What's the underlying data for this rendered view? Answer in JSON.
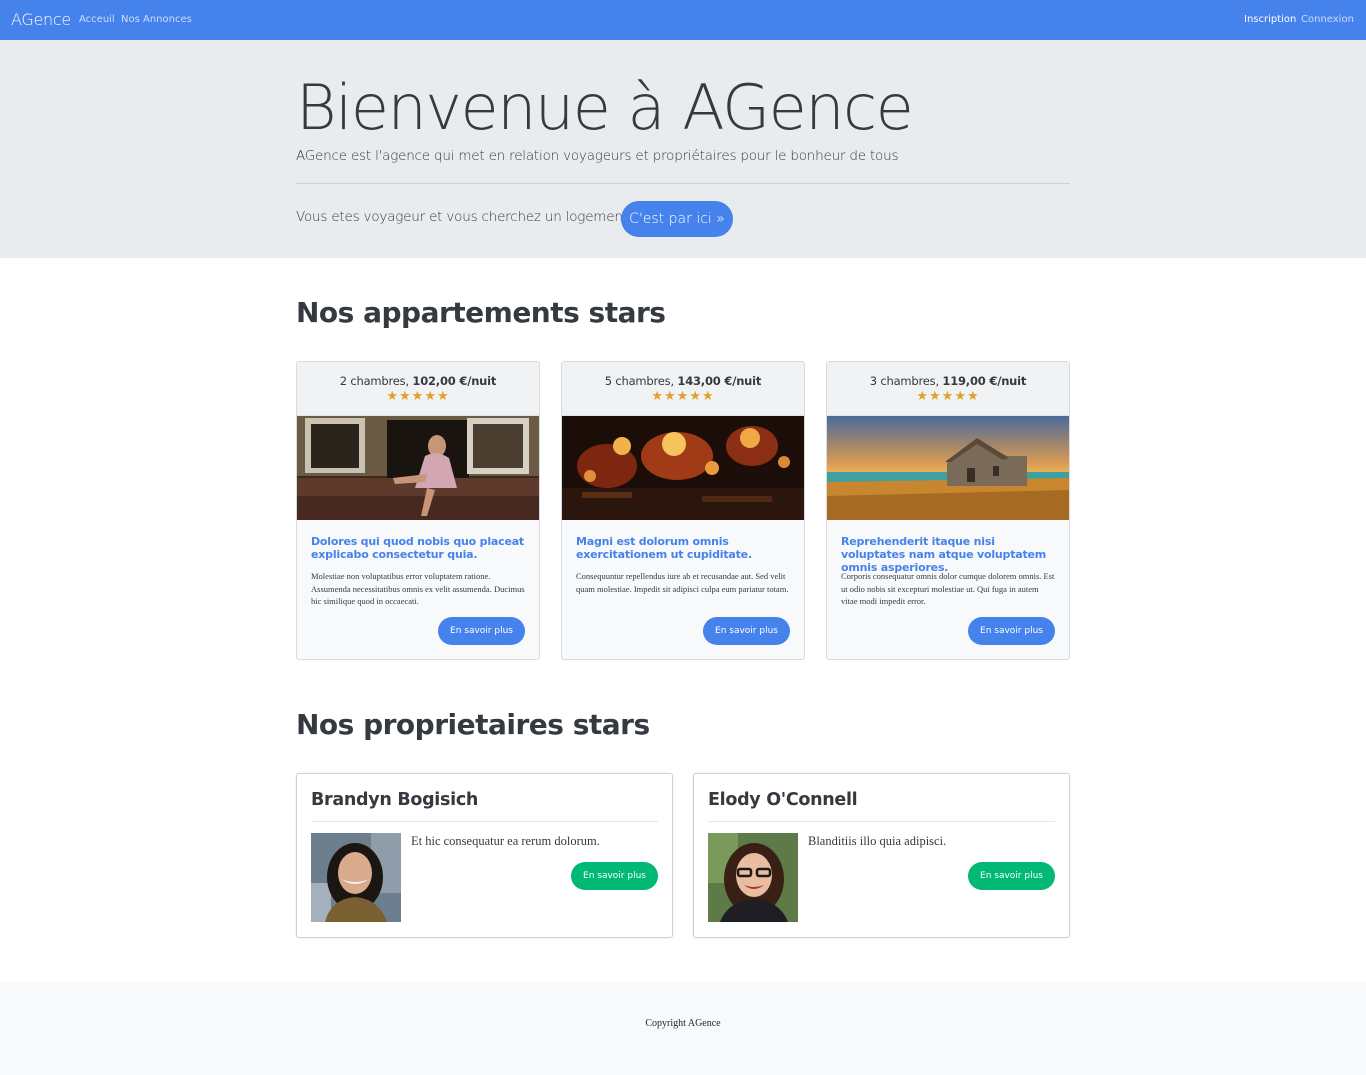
{
  "navbar": {
    "brand": "AGence",
    "links": [
      {
        "label": "Acceuil"
      },
      {
        "label": "Nos Annonces"
      },
      {
        "label": "Inscription"
      },
      {
        "label": "Connexion"
      }
    ]
  },
  "hero": {
    "title": "Bienvenue à AGence",
    "lead": "AGence est l'agence qui met en relation voyageurs et propriétaires pour le bonheur de tous",
    "question": "Vous etes voyageur et vous cherchez un logement?",
    "cta_label": "C'est par ici »"
  },
  "apartments": {
    "section_title": "Nos appartements stars",
    "cards": [
      {
        "rooms": "2 chambres,",
        "price": "102,00 €/nuit",
        "rating": 5,
        "stars": "★★★★★",
        "title": "Dolores qui quod nobis quo placeat explicabo consectetur quia.",
        "description": "Molestiae non voluptatibus error voluptatem ratione. Assumenda necessitatibus omnis ex velit assumenda. Ducimus hic similique quod in occaecati.",
        "button_label": "En savoir plus"
      },
      {
        "rooms": "5 chambres,",
        "price": "143,00 €/nuit",
        "rating": 5,
        "stars": "★★★★★",
        "title": "Magni est dolorum omnis exercitationem ut cupiditate.",
        "description": "Consequuntur repellendus iure ab et recusandae aut. Sed velit quam molestiae. Impedit sit adipisci culpa eum pariatur totam.",
        "button_label": "En savoir plus"
      },
      {
        "rooms": "3 chambres,",
        "price": "119,00 €/nuit",
        "rating": 5,
        "stars": "★★★★★",
        "title": "Reprehenderit itaque nisi voluptates nam atque voluptatem omnis asperiores.",
        "description": "Corporis consequatur omnis dolor cumque dolorem omnis. Est ut odio nobis sit excepturi molestiae ut. Qui fuga in autem vitae modi impedit error.",
        "button_label": "En savoir plus"
      }
    ]
  },
  "owners": {
    "section_title": "Nos proprietaires stars",
    "cards": [
      {
        "name": "Brandyn Bogisich",
        "quote": "Et hic consequatur ea rerum dolorum.",
        "button_label": "En savoir plus"
      },
      {
        "name": "Elody O'Connell",
        "quote": "Blanditiis illo quia adipisci.",
        "button_label": "En savoir plus"
      }
    ]
  },
  "footer": {
    "copyright": "Copyright AGence"
  },
  "colors": {
    "primary": "#4582ec",
    "success": "#02b875",
    "star": "#e0a02a",
    "jumbotron_bg": "#e9ecef"
  }
}
